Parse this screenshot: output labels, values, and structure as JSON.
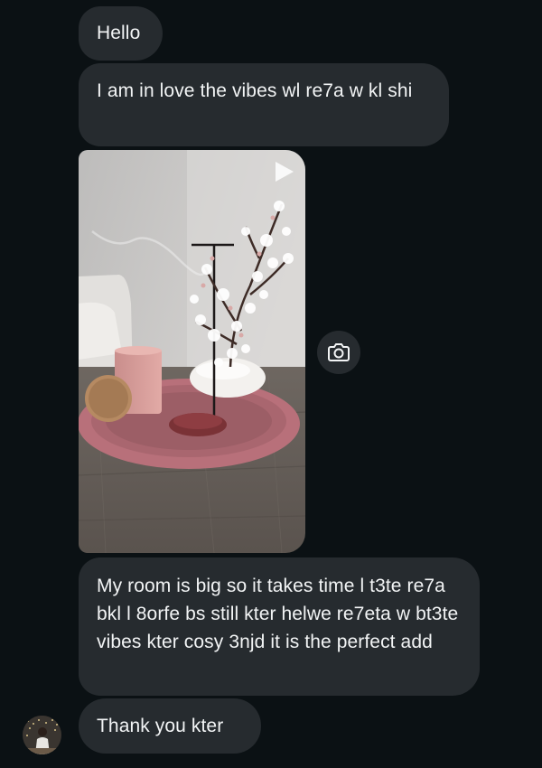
{
  "messages": [
    {
      "text": "Hello"
    },
    {
      "text": "I am in love the vibes wl re7a w kl shi"
    },
    {
      "text": "My room is big so it takes time l t3te re7a bkl l 8orfe bs still kter helwe re7eta w bt3te vibes kter cosy 3njd it is the perfect add"
    },
    {
      "text": "Thank you kter"
    }
  ],
  "media": {
    "type": "video",
    "icon": "play-icon",
    "action_icon": "camera-icon"
  },
  "avatar": {
    "icon": "user-avatar"
  },
  "colors": {
    "background": "#0b1114",
    "bubble": "#262b2f",
    "text": "#f2f4f5"
  }
}
